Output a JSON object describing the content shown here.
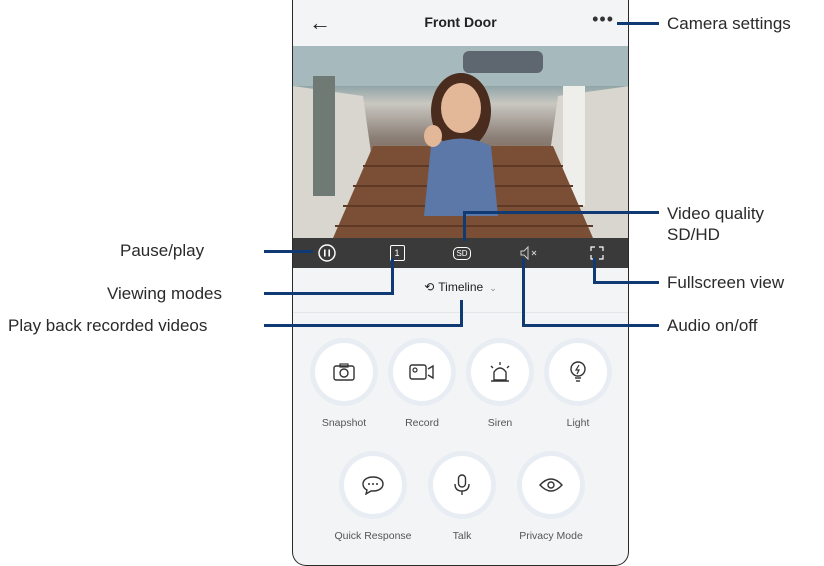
{
  "header": {
    "title": "Front Door"
  },
  "timeline": {
    "label": "Timeline"
  },
  "actions": [
    {
      "label": "Snapshot",
      "icon": "camera-icon"
    },
    {
      "label": "Record",
      "icon": "video-record-icon"
    },
    {
      "label": "Siren",
      "icon": "siren-icon"
    },
    {
      "label": "Light",
      "icon": "light-bulb-icon"
    },
    {
      "label": "Quick Response",
      "icon": "chat-bubble-icon"
    },
    {
      "label": "Talk",
      "icon": "microphone-icon"
    },
    {
      "label": "Privacy Mode",
      "icon": "eye-icon"
    }
  ],
  "controls": {
    "viewing_mode": "1",
    "quality": "SD"
  },
  "callouts": {
    "camera_settings": "Camera settings",
    "video_quality_1": "Video quality",
    "video_quality_2": "SD/HD",
    "pause_play": "Pause/play",
    "fullscreen": "Fullscreen view",
    "viewing_modes": "Viewing modes",
    "audio": "Audio on/off",
    "playback": "Play back recorded videos"
  },
  "colors": {
    "accent": "#0f3a73",
    "control_bar": "#3a3a3a",
    "panel": "#f3f4f6"
  }
}
